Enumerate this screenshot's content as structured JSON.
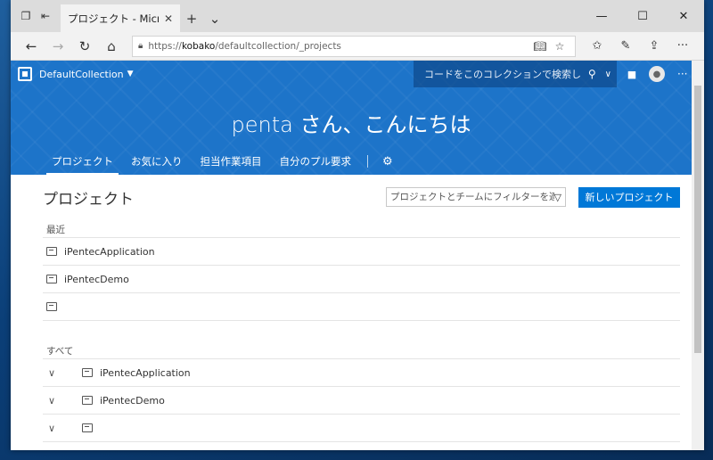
{
  "browser": {
    "tab_title": "プロジェクト - Microsoft Te",
    "url_prefix": "https://",
    "url_host": "kobako",
    "url_path": "/defaultcollection/_projects"
  },
  "header": {
    "collection": "DefaultCollection",
    "search_placeholder": "コードをこのコレクションで検索しま"
  },
  "hero": {
    "greeting": "penta さん、こんにちは",
    "tabs": [
      "プロジェクト",
      "お気に入り",
      "担当作業項目",
      "自分のプル要求"
    ]
  },
  "main": {
    "title": "プロジェクト",
    "filter_placeholder": "プロジェクトとチームにフィルターを適用",
    "new_project_label": "新しいプロジェクト",
    "recent_label": "最近",
    "recent": [
      "iPentecApplication",
      "iPentecDemo",
      ""
    ],
    "all_label": "すべて",
    "all": [
      "iPentecApplication",
      "iPentecDemo",
      ""
    ]
  }
}
